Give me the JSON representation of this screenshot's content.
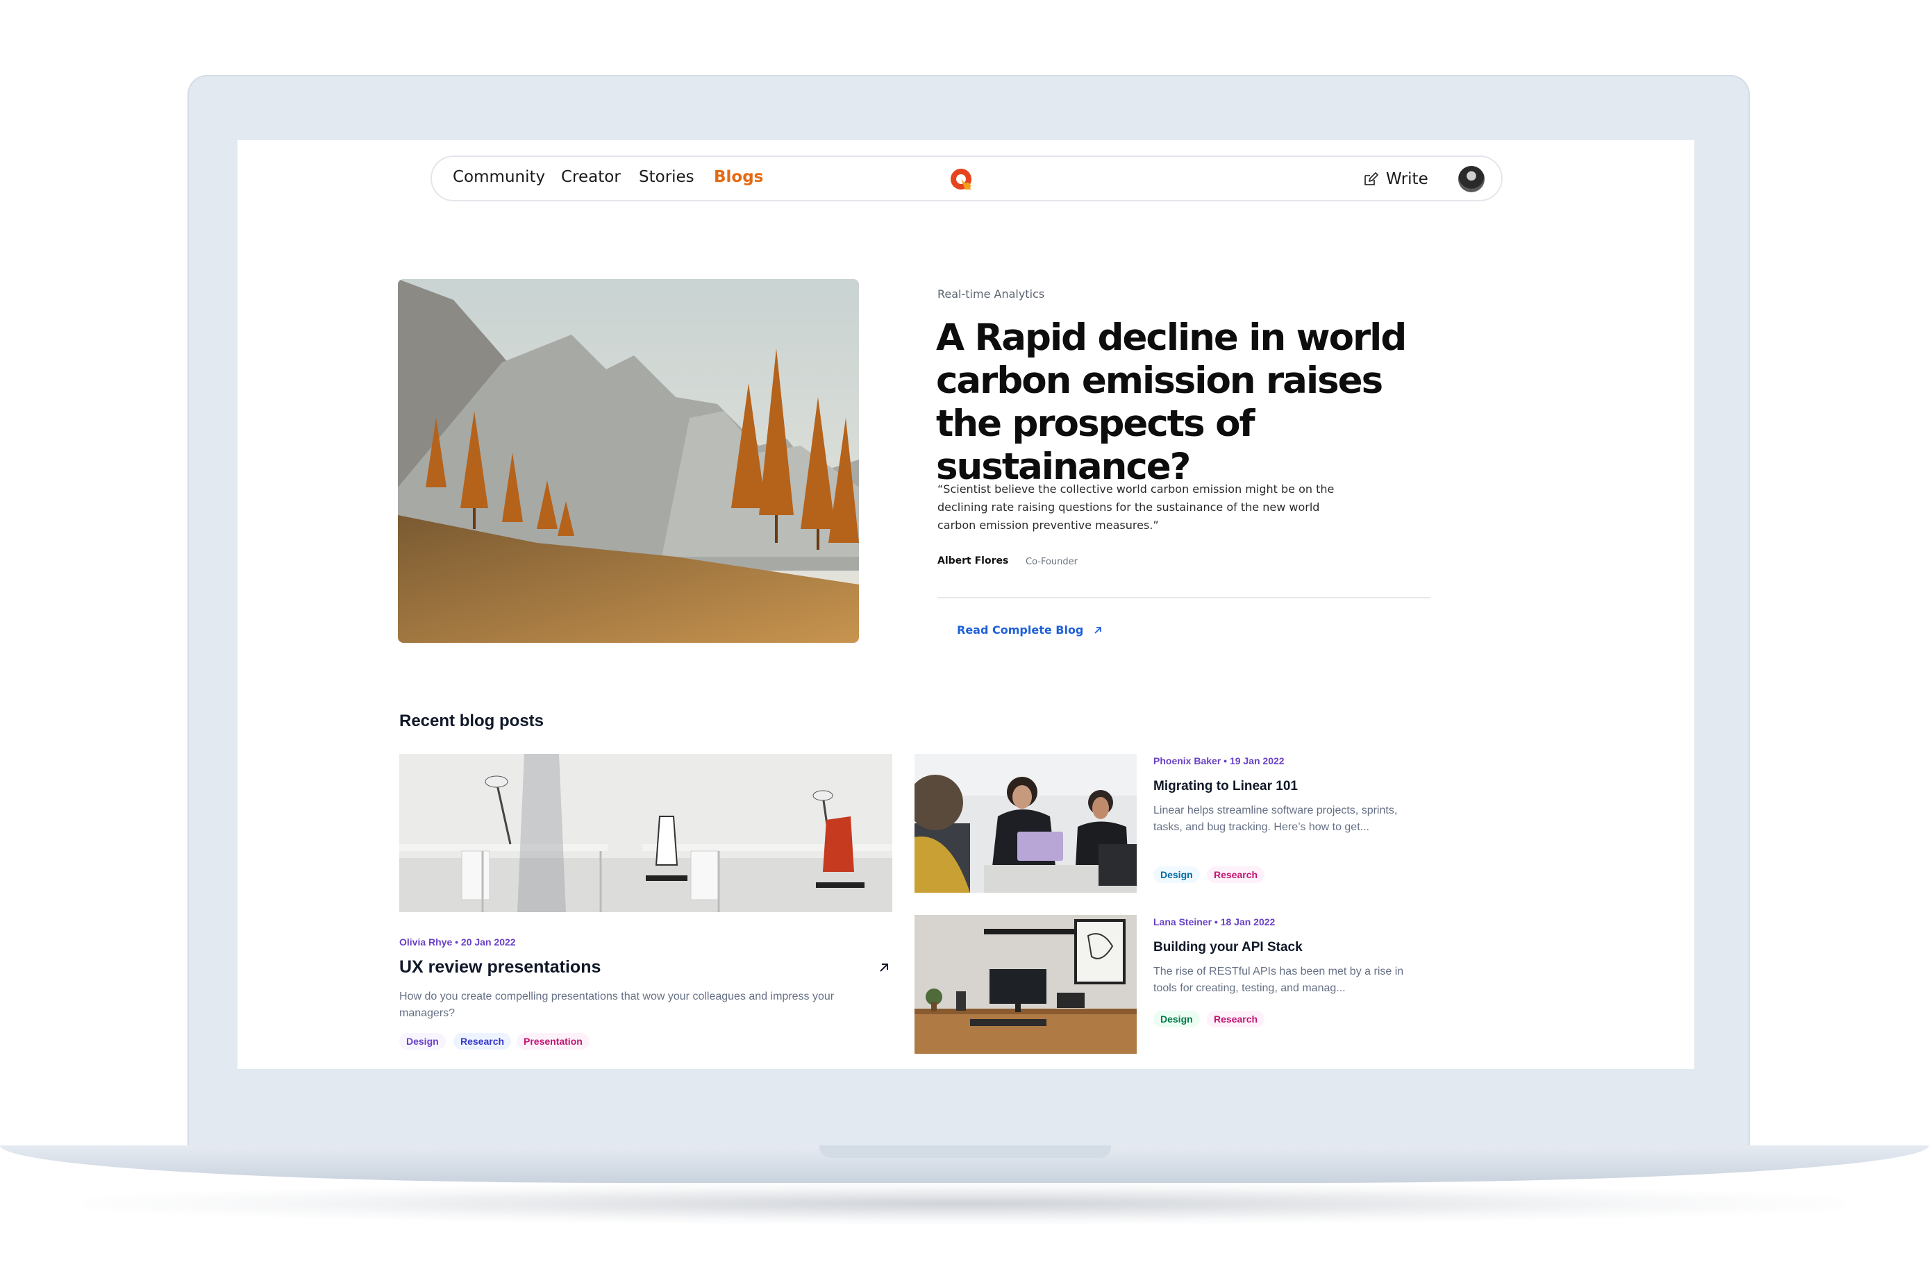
{
  "nav": {
    "links": [
      "Community",
      "Creator",
      "Stories",
      "Blogs"
    ],
    "active": "Blogs",
    "write_label": "Write",
    "accent": "#e56a13"
  },
  "hero": {
    "category": "Real-time Analytics",
    "title": "A Rapid decline in world carbon emission raises the prospects of sustainance?",
    "quote": "“Scientist believe the collective world carbon emission might be on the declining rate raising questions for the sustainance of the new world carbon emission preventive measures.”",
    "author": "Albert Flores",
    "role": "Co-Founder",
    "read_label": "Read Complete Blog"
  },
  "recent": {
    "heading": "Recent blog posts",
    "posts": [
      {
        "meta": "Olivia Rhye • 20 Jan 2022",
        "title": "UX review presentations",
        "excerpt": "How do you create compelling presentations that wow your colleagues and impress your managers?",
        "tags": [
          "Design",
          "Research",
          "Presentation"
        ]
      },
      {
        "meta": "Phoenix Baker • 19 Jan 2022",
        "title": "Migrating to Linear 101",
        "excerpt": "Linear helps streamline software projects, sprints, tasks, and bug tracking. Here’s how to get...",
        "tags": [
          "Design",
          "Research"
        ]
      },
      {
        "meta": "Lana Steiner • 18 Jan 2022",
        "title": "Building your API Stack",
        "excerpt": "The rise of RESTful APIs has been met by a rise in tools for creating, testing, and manag...",
        "tags": [
          "Design",
          "Research"
        ]
      }
    ]
  }
}
